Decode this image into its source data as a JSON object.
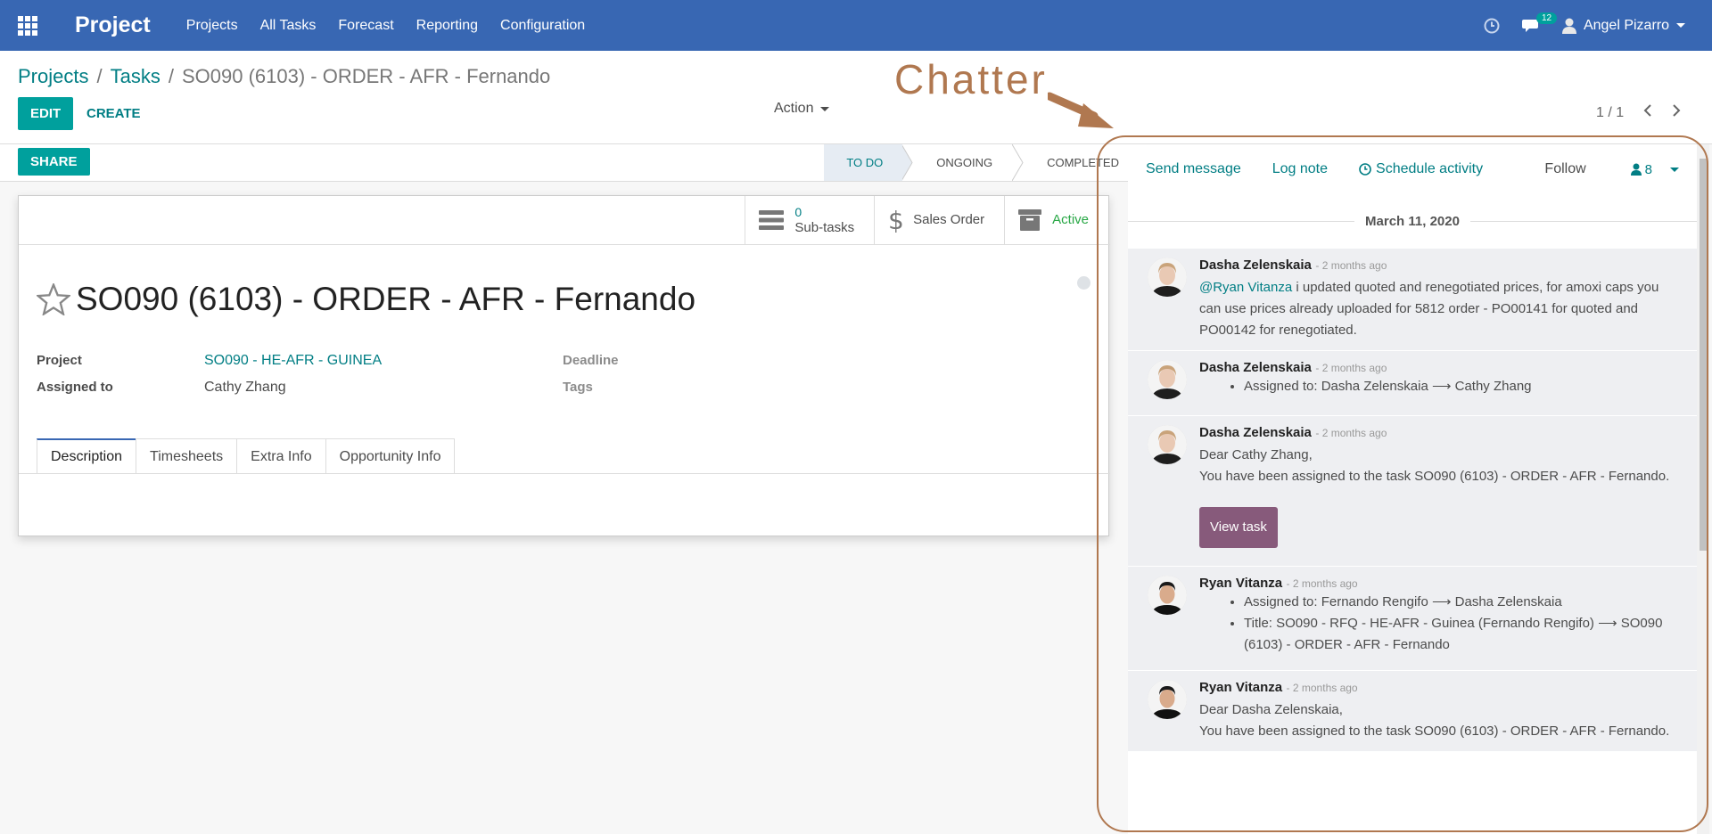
{
  "navbar": {
    "brand": "Project",
    "menu": [
      "Projects",
      "All Tasks",
      "Forecast",
      "Reporting",
      "Configuration"
    ],
    "message_count": "12",
    "user_name": "Angel Pizarro"
  },
  "breadcrumb": {
    "projects": "Projects",
    "tasks": "Tasks",
    "current": "SO090 (6103) - ORDER - AFR - Fernando",
    "separator": "/"
  },
  "toolbar": {
    "edit_label": "EDIT",
    "create_label": "CREATE",
    "action_label": "Action",
    "pager_value": "1 / 1"
  },
  "statusbar": {
    "share_label": "SHARE",
    "stages": [
      "TO DO",
      "ONGOING",
      "COMPLETED"
    ],
    "active_stage": "TO DO"
  },
  "smart_buttons": {
    "subtasks_count": "0",
    "subtasks_label": "Sub-tasks",
    "sales_order_label": "Sales Order",
    "active_label": "Active"
  },
  "task": {
    "title": "SO090 (6103) - ORDER - AFR - Fernando",
    "project_label": "Project",
    "project_value": "SO090 - HE-AFR - GUINEA",
    "assigned_label": "Assigned to",
    "assigned_value": "Cathy Zhang",
    "deadline_label": "Deadline",
    "tags_label": "Tags"
  },
  "tabs": [
    "Description",
    "Timesheets",
    "Extra Info",
    "Opportunity Info"
  ],
  "chatter": {
    "send_message": "Send message",
    "log_note": "Log note",
    "schedule_activity": "Schedule activity",
    "follow": "Follow",
    "followers_count": "8",
    "date_separator": "March 11, 2020",
    "messages": [
      {
        "author": "Dasha Zelenskaia",
        "date": "- 2 months ago",
        "mention": "@Ryan Vitanza",
        "text": " i updated quoted and renegotiated prices, for amoxi caps you can use prices already uploaded for 5812 order - PO00141 for quoted and PO00142 for renegotiated."
      },
      {
        "author": "Dasha Zelenskaia",
        "date": "- 2 months ago",
        "items": [
          "Assigned to: Dasha Zelenskaia ⟶ Cathy Zhang"
        ]
      },
      {
        "author": "Dasha Zelenskaia",
        "date": "- 2 months ago",
        "line1": "Dear Cathy Zhang,",
        "line2": "You have been assigned to the task SO090 (6103) - ORDER - AFR - Fernando.",
        "button": "View task"
      },
      {
        "author": "Ryan Vitanza",
        "date": "- 2 months ago",
        "items": [
          "Assigned to: Fernando Rengifo ⟶ Dasha Zelenskaia",
          "Title: SO090 - RFQ - HE-AFR - Guinea (Fernando Rengifo) ⟶ SO090 (6103) - ORDER - AFR - Fernando"
        ]
      },
      {
        "author": "Ryan Vitanza",
        "date": "- 2 months ago",
        "line1": "Dear Dasha Zelenskaia,",
        "line2": "You have been assigned to the task SO090 (6103) - ORDER - AFR - Fernando."
      }
    ]
  },
  "annotation": {
    "label": "Chatter",
    "color": "#b07850"
  },
  "colors": {
    "navbar": "#3867b3",
    "primary": "#00a09d",
    "link": "#017e84",
    "view_task": "#875a7b"
  }
}
